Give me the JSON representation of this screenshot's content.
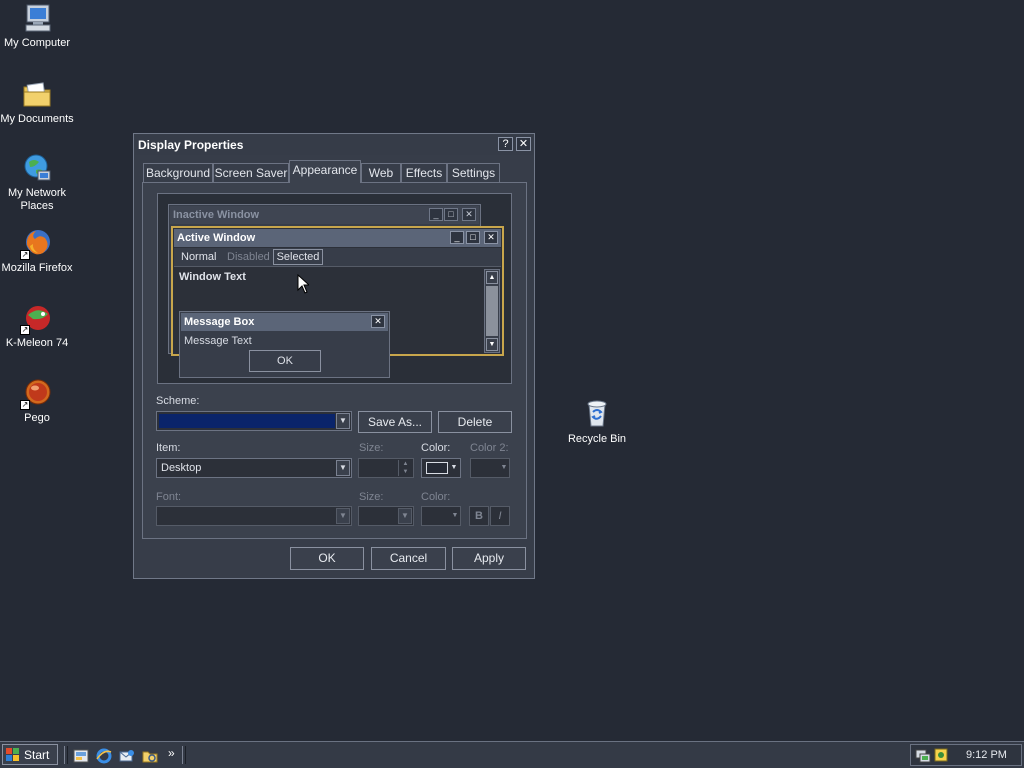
{
  "desktop": {
    "icons": [
      {
        "label": "My Computer",
        "icon": "computer-icon"
      },
      {
        "label": "My Documents",
        "icon": "folder-icon"
      },
      {
        "label": "My Network Places",
        "icon": "network-icon"
      },
      {
        "label": "Mozilla Firefox",
        "icon": "firefox-icon"
      },
      {
        "label": "K-Meleon 74",
        "icon": "kmeleon-icon"
      },
      {
        "label": "Pego",
        "icon": "pego-icon"
      },
      {
        "label": "Recycle Bin",
        "icon": "recycle-bin-icon"
      }
    ]
  },
  "window": {
    "title": "Display Properties",
    "help_glyph": "?",
    "close_glyph": "✕",
    "tabs": [
      "Background",
      "Screen Saver",
      "Appearance",
      "Web",
      "Effects",
      "Settings"
    ],
    "active_tab": "Appearance"
  },
  "preview": {
    "inactive_title": "Inactive Window",
    "active_title": "Active Window",
    "menu": {
      "normal": "Normal",
      "disabled": "Disabled",
      "selected": "Selected"
    },
    "window_text": "Window Text",
    "message_title": "Message Box",
    "message_text": "Message Text",
    "message_ok": "OK"
  },
  "form": {
    "scheme_label": "Scheme:",
    "scheme_value": "",
    "save_as": "Save As...",
    "delete": "Delete",
    "item_label": "Item:",
    "item_value": "Desktop",
    "size_label": "Size:",
    "color_label": "Color:",
    "color2_label": "Color 2:",
    "font_label": "Font:",
    "font_size_label": "Size:",
    "font_color_label": "Color:",
    "bold_glyph": "B",
    "italic_glyph": "I",
    "desktop_color": "#252a35"
  },
  "footer": {
    "ok": "OK",
    "cancel": "Cancel",
    "apply": "Apply"
  },
  "taskbar": {
    "start": "Start",
    "chevron": "»",
    "time": "9:12 PM"
  },
  "colors": {
    "selection": "#0a246a",
    "accent_border": "#c8a64c",
    "titlebar": "#5b6578"
  }
}
